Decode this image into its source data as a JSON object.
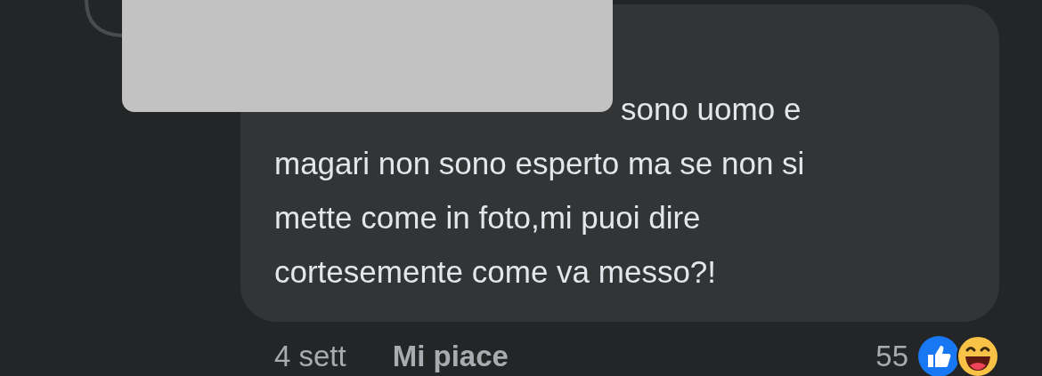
{
  "comment": {
    "text": "sono uomo e\nmagari non sono esperto ma se non si\nmette come in foto,mi puoi dire\ncortesemente come va messo?!",
    "redacted": true
  },
  "footer": {
    "time": "4 sett",
    "like_action": "Mi piace",
    "reaction_count": "55",
    "reactions": [
      {
        "kind": "like"
      },
      {
        "kind": "haha"
      }
    ]
  }
}
